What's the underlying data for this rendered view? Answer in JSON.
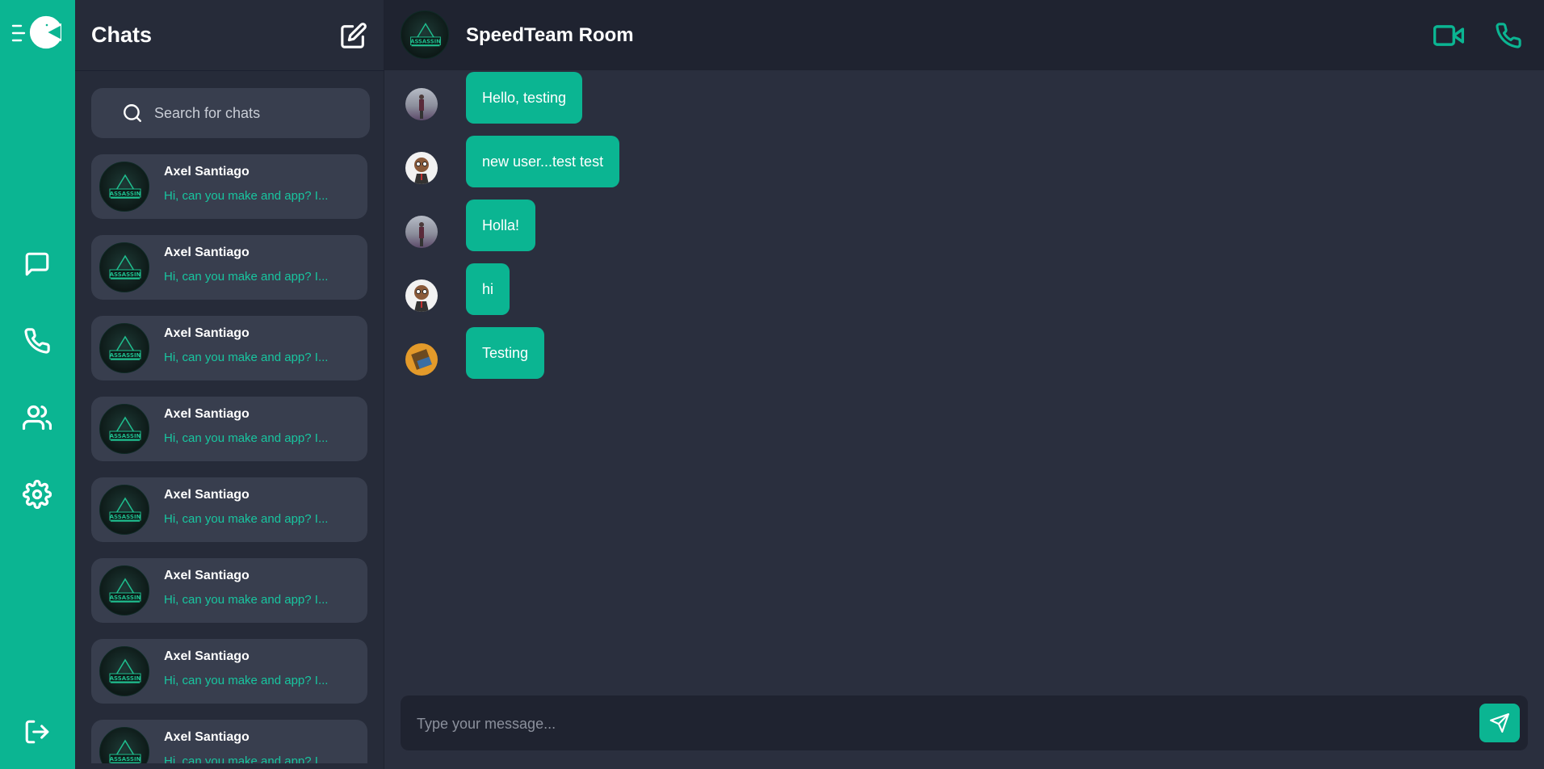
{
  "rail": {
    "logo": "chat-logo-icon",
    "items": [
      {
        "name": "chats",
        "icon": "message-square-icon"
      },
      {
        "name": "calls",
        "icon": "phone-icon"
      },
      {
        "name": "contacts",
        "icon": "users-icon"
      },
      {
        "name": "settings",
        "icon": "gear-icon"
      }
    ],
    "logout_icon": "logout-icon"
  },
  "list": {
    "title": "Chats",
    "compose_icon": "edit-icon",
    "search": {
      "placeholder": "Search for chats",
      "icon": "search-icon"
    },
    "items": [
      {
        "name": "Axel Santiago",
        "preview": "Hi, can you make and app? I..."
      },
      {
        "name": "Axel Santiago",
        "preview": "Hi, can you make and app? I..."
      },
      {
        "name": "Axel Santiago",
        "preview": "Hi, can you make and app? I..."
      },
      {
        "name": "Axel Santiago",
        "preview": "Hi, can you make and app? I..."
      },
      {
        "name": "Axel Santiago",
        "preview": "Hi, can you make and app? I..."
      },
      {
        "name": "Axel Santiago",
        "preview": "Hi, can you make and app? I..."
      },
      {
        "name": "Axel Santiago",
        "preview": "Hi, can you make and app? I..."
      },
      {
        "name": "Axel Santiago",
        "preview": "Hi, can you make and app? I..."
      }
    ]
  },
  "conversation": {
    "title": "SpeedTeam Room",
    "video_icon": "video-icon",
    "call_icon": "phone-icon",
    "messages": [
      {
        "text": "Hello, testing"
      },
      {
        "text": "new user...test test"
      },
      {
        "text": "Holla!"
      },
      {
        "text": "hi"
      },
      {
        "text": "Testing"
      }
    ],
    "composer": {
      "placeholder": "Type your message...",
      "send_icon": "send-icon"
    }
  },
  "colors": {
    "accent": "#0bb592",
    "background": "#2a2f3e",
    "panel": "#262b39",
    "card": "#383e4e",
    "header": "#1f2330"
  }
}
